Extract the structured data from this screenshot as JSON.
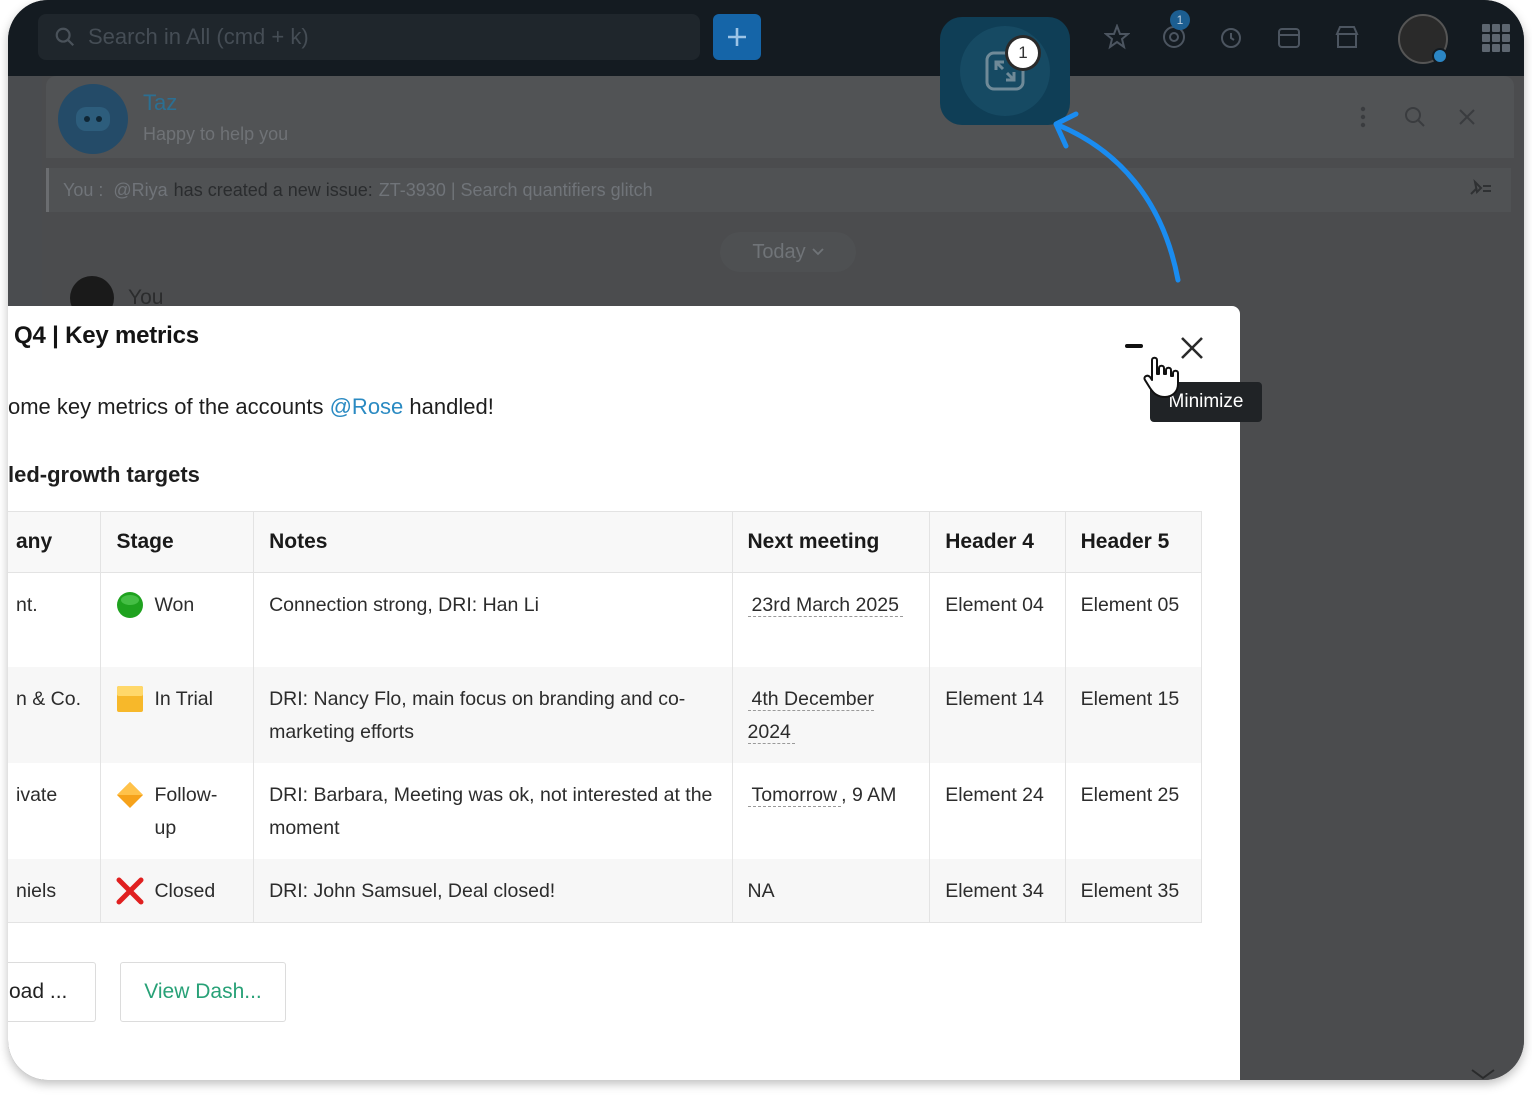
{
  "topbar": {
    "search_placeholder": "Search in All (cmd + k)",
    "mention_badge": "1"
  },
  "chat": {
    "bot_name": "Taz",
    "bot_status": "Happy to help you",
    "pinned": {
      "you": "You :",
      "mention": "@Riya",
      "text": "has created a new issue:",
      "link": "ZT-3930 | Search quantifiers glitch"
    },
    "today_label": "Today",
    "sender": "You"
  },
  "float_badge": "1",
  "card": {
    "title": "Q4 | Key metrics",
    "tooltip": "Minimize",
    "intro_prefix": "ome key metrics of the accounts",
    "intro_mention": "@Rose",
    "intro_suffix": "handled!",
    "subheading": "led-growth targets",
    "columns": [
      "any",
      "Stage",
      "Notes",
      "Next meeting",
      "Header 4",
      "Header 5"
    ],
    "rows": [
      {
        "company": "nt.",
        "stage": "Won",
        "stage_icon": "green-circle",
        "notes": "Connection strong, DRI: Han Li",
        "meeting": "23rd March 2025",
        "h4": "Element 04",
        "h5": "Element 05"
      },
      {
        "company": "n & Co.",
        "stage": "In Trial",
        "stage_icon": "yellow-square",
        "notes": "DRI: Nancy Flo, main focus on branding and co-marketing efforts",
        "meeting": "4th December 2024",
        "h4": "Element 14",
        "h5": "Element 15"
      },
      {
        "company": "ivate",
        "stage": "Follow-up",
        "stage_icon": "orange-diamond",
        "notes": "DRI: Barbara, Meeting was ok, not interested at the moment",
        "meeting": "Tomorrow",
        "meeting_suffix": ", 9 AM",
        "h4": "Element 24",
        "h5": "Element 25"
      },
      {
        "company": "niels",
        "stage": "Closed",
        "stage_icon": "red-cross",
        "notes": "DRI: John Samsuel, Deal closed!",
        "meeting": "NA",
        "h4": "Element 34",
        "h5": "Element 35"
      }
    ],
    "button_download": "oad ...",
    "button_dashboard": "View Dash..."
  },
  "colors": {
    "accent_blue": "#1565a8",
    "mention_blue": "#2a8ac2",
    "dashboard_green": "#28a177",
    "arrow_blue": "#1a8cf0"
  }
}
